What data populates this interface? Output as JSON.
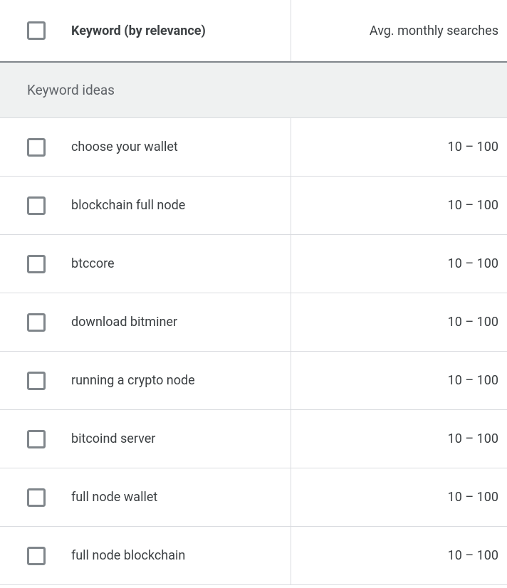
{
  "header": {
    "keyword_col": "Keyword (by relevance)",
    "searches_col": "Avg. monthly searches"
  },
  "section_title": "Keyword ideas",
  "rows": [
    {
      "keyword": "choose your wallet",
      "searches": "10 – 100"
    },
    {
      "keyword": "blockchain full node",
      "searches": "10 – 100"
    },
    {
      "keyword": "btccore",
      "searches": "10 – 100"
    },
    {
      "keyword": "download bitminer",
      "searches": "10 – 100"
    },
    {
      "keyword": "running a crypto node",
      "searches": "10 – 100"
    },
    {
      "keyword": "bitcoind server",
      "searches": "10 – 100"
    },
    {
      "keyword": "full node wallet",
      "searches": "10 – 100"
    },
    {
      "keyword": "full node blockchain",
      "searches": "10 – 100"
    }
  ]
}
